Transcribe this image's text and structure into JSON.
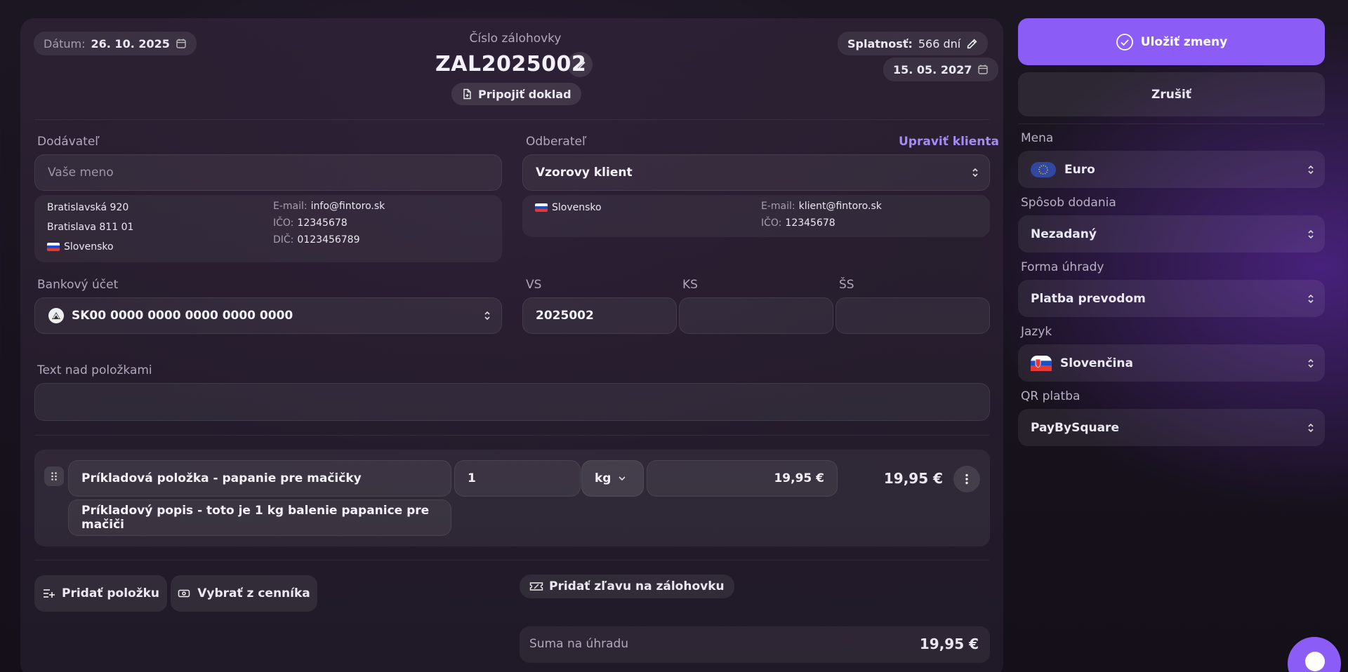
{
  "header": {
    "date_label": "Dátum:",
    "date_value": "26. 10. 2025",
    "invoice_caption": "Číslo zálohovky",
    "invoice_number": "ZAL2025002",
    "attach_label": "Pripojiť doklad",
    "due_label": "Splatnosť:",
    "due_days": "566 dní",
    "due_date": "15. 05. 2027"
  },
  "supplier": {
    "label": "Dodávateľ",
    "name_placeholder": "Vaše meno",
    "address_line1": "Bratislavská 920",
    "address_line2": "Bratislava 811 01",
    "country": "Slovensko",
    "email_label": "E-mail:",
    "email": "info@fintoro.sk",
    "ico_label": "IČO:",
    "ico": "12345678",
    "dic_label": "DIČ:",
    "dic": "0123456789"
  },
  "client": {
    "label": "Odberateľ",
    "edit_link": "Upraviť klienta",
    "selected": "Vzorovy klient",
    "country": "Slovensko",
    "email_label": "E-mail:",
    "email": "klient@fintoro.sk",
    "ico_label": "IČO:",
    "ico": "12345678"
  },
  "bank": {
    "label": "Bankový účet",
    "iban": "SK00 0000 0000 0000 0000 0000"
  },
  "symbols": {
    "vs_label": "VS",
    "vs_value": "2025002",
    "ks_label": "KS",
    "ks_value": "",
    "ss_label": "ŠS",
    "ss_value": ""
  },
  "text_above": {
    "label": "Text nad položkami",
    "value": ""
  },
  "item": {
    "name": "Príkladová položka - papanie pre mačičky",
    "quantity": "1",
    "unit": "kg",
    "unit_price": "19,95 €",
    "total": "19,95 €",
    "description": "Príkladový popis - toto je 1 kg balenie papanice pre mačiči"
  },
  "actions": {
    "add_item": "Pridať položku",
    "from_pricelist": "Vybrať z cenníka",
    "add_discount": "Pridať zľavu na zálohovku"
  },
  "summary": {
    "total_label": "Suma na úhradu",
    "total_value": "19,95 €"
  },
  "sidebar": {
    "save_label": "Uložiť zmeny",
    "cancel_label": "Zrušiť",
    "currency_label": "Mena",
    "currency_value": "Euro",
    "delivery_label": "Spôsob dodania",
    "delivery_value": "Nezadaný",
    "payment_label": "Forma úhrady",
    "payment_value": "Platba prevodom",
    "language_label": "Jazyk",
    "language_value": "Slovenčina",
    "qr_label": "QR platba",
    "qr_value": "PayBySquare"
  },
  "colors": {
    "accent": "#8b5cf6",
    "accent_link": "#a48bf5",
    "background": "#17121c"
  }
}
